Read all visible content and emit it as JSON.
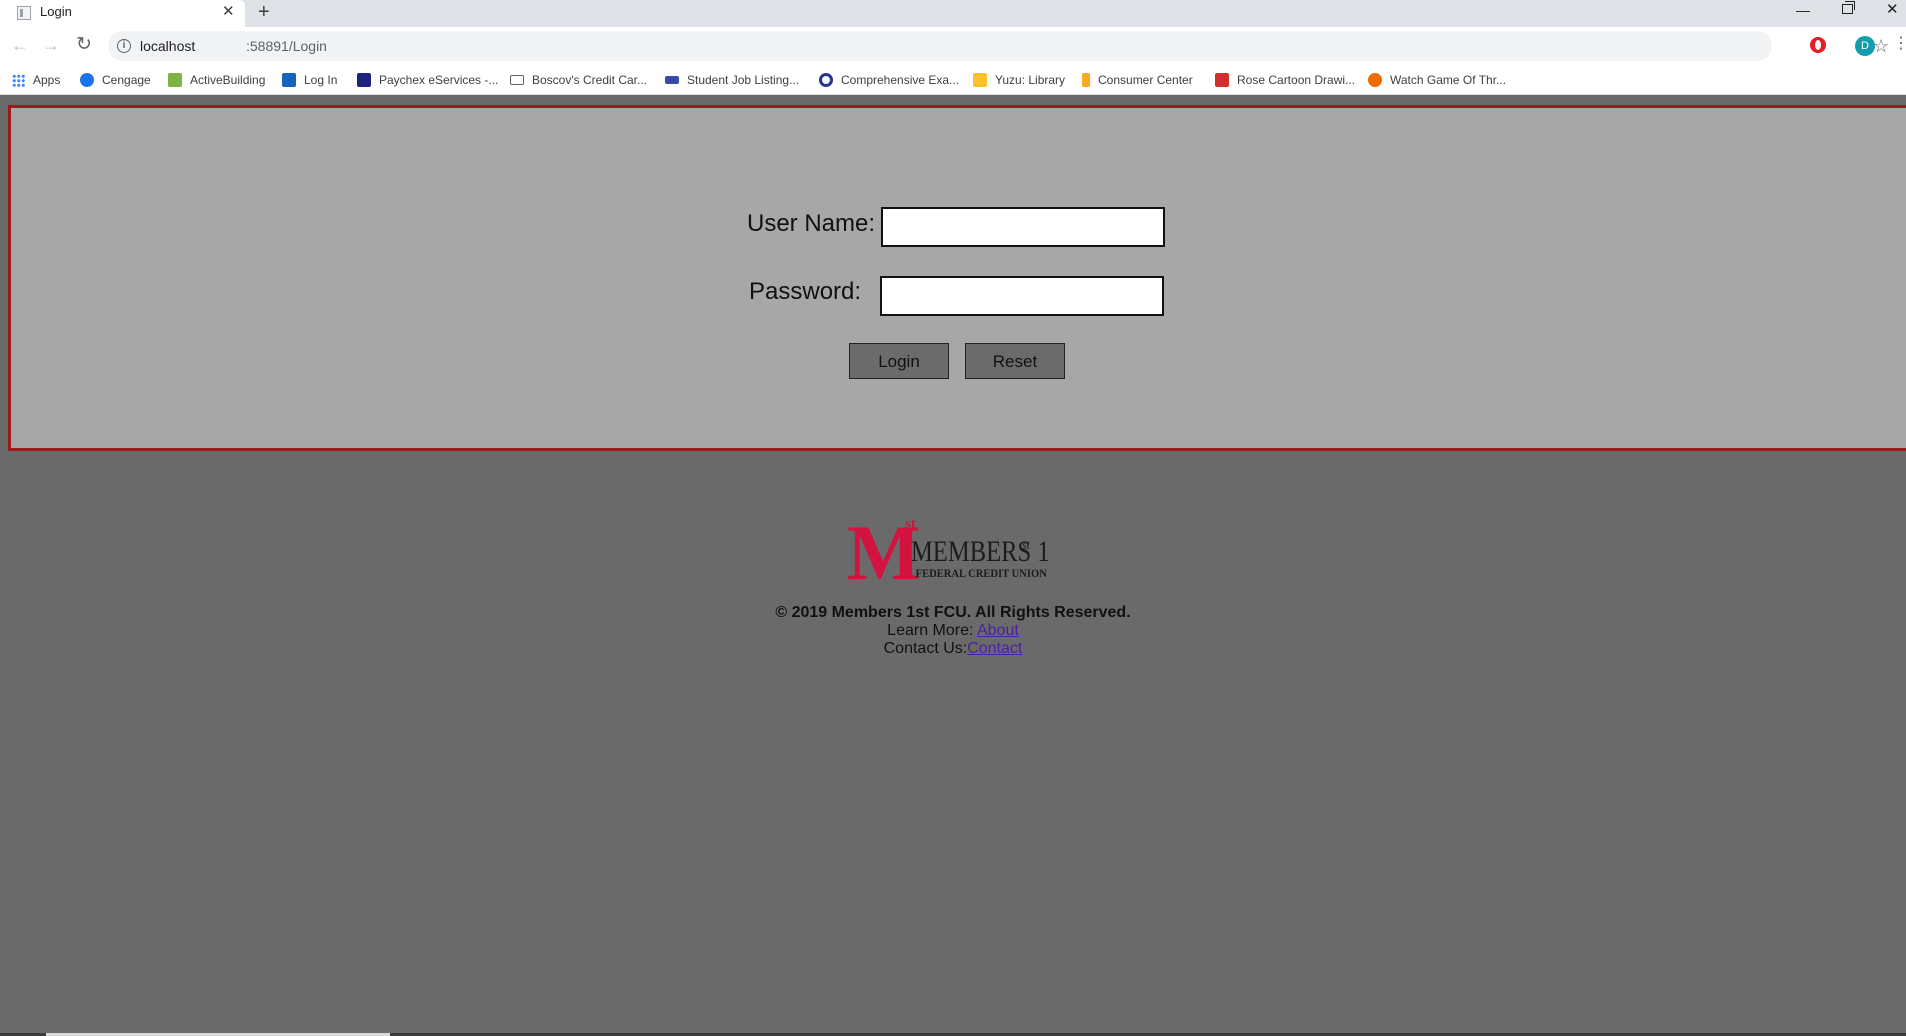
{
  "browser": {
    "tab_title": "Login",
    "url_host": "localhost",
    "url_path": ":58891/Login",
    "avatar_initial": "D",
    "bookmarks": [
      {
        "label": "Apps",
        "icon": "apps-grid-icon",
        "color": "#4285f4"
      },
      {
        "label": "Cengage",
        "icon": "cengage-icon",
        "color": "#1a73e8"
      },
      {
        "label": "ActiveBuilding",
        "icon": "activebuilding-icon",
        "color": "#7cb342"
      },
      {
        "label": "Log In",
        "icon": "login-bookmark-icon",
        "color": "#1565c0"
      },
      {
        "label": "Paychex eServices -...",
        "icon": "paychex-icon",
        "color": "#1a237e"
      },
      {
        "label": "Boscov's Credit Car...",
        "icon": "card-icon",
        "color": "#5f6368"
      },
      {
        "label": "Student Job Listing...",
        "icon": "jobs-icon",
        "color": "#3949ab"
      },
      {
        "label": "Comprehensive Exa...",
        "icon": "q-icon",
        "color": "#283593"
      },
      {
        "label": "Yuzu: Library",
        "icon": "yuzu-icon",
        "color": "#fbc02d"
      },
      {
        "label": "Consumer Center",
        "icon": "consumer-icon",
        "color": "#f9a825"
      },
      {
        "label": "Rose Cartoon Drawi...",
        "icon": "rose-icon",
        "color": "#d32f2f"
      },
      {
        "label": "Watch Game Of Thr...",
        "icon": "game-icon",
        "color": "#ef6c00"
      }
    ]
  },
  "login": {
    "username_label": "User Name:",
    "password_label": "Password:",
    "username_value": "",
    "password_value": "",
    "login_button": "Login",
    "reset_button": "Reset"
  },
  "footer": {
    "logo_letter": "M",
    "logo_sup": "st",
    "logo_name": "MEMBERS 1",
    "logo_name_sup": "st",
    "logo_sub": "FEDERAL CREDIT UNION",
    "copyright": "© 2019 Members 1st FCU. All Rights Reserved.",
    "learn_more_label": "Learn More: ",
    "about_link": "About",
    "contact_label": "Contact Us:",
    "contact_link": "Contact"
  },
  "colors": {
    "panel_bg": "#a7a7a7",
    "panel_border": "#9b1b1b",
    "page_bg": "#6a6a6a",
    "logo_red": "#d3123f",
    "link": "#4b1fa6"
  }
}
